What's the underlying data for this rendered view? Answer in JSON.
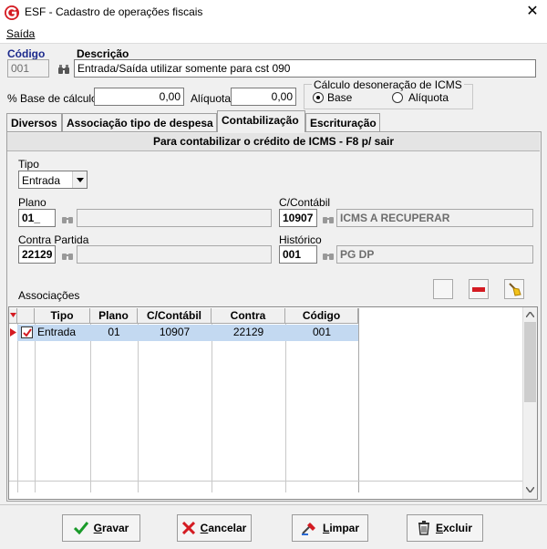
{
  "window": {
    "title": "ESF - Cadastro de operações fiscais",
    "close": "✕"
  },
  "menu": {
    "saida": "Saída"
  },
  "header": {
    "codigo_label": "Código",
    "codigo_value": "001",
    "descricao_label": "Descrição",
    "descricao_value": "Entrada/Saída utilizar somente para cst 090",
    "base_label": "% Base de cálculo",
    "base_value": "0,00",
    "aliquota_label": "Alíquota",
    "aliquota_value": "0,00",
    "calc_group_label": "Cálculo desoneração de ICMS",
    "radio_base": "Base",
    "radio_aliquota": "Alíquota",
    "radio_selected": "Base"
  },
  "tabs": [
    "Diversos",
    "Associação tipo de despesa",
    "Contabilização",
    "Escrituração"
  ],
  "active_tab": "Contabilização",
  "panel": {
    "title": "Para contabilizar o crédito de ICMS -  F8 p/ sair",
    "tipo_label": "Tipo",
    "tipo_value": "Entrada",
    "plano_label": "Plano",
    "plano_value": "01_",
    "ccontabil_label": "C/Contábil",
    "ccontabil_value": "10907",
    "ccontabil_desc": "ICMS A RECUPERAR",
    "contra_label": "Contra Partida",
    "contra_value": "22129",
    "historico_label": "Histórico",
    "historico_value": "001",
    "historico_desc": "PG DP",
    "assoc_label": "Associações"
  },
  "grid": {
    "columns": [
      "Tipo",
      "Plano",
      "C/Contábil",
      "Contra",
      "Código"
    ],
    "rows": [
      {
        "checked": true,
        "tipo": "Entrada",
        "plano": "01",
        "ccontabil": "10907",
        "contra": "22129",
        "codigo": "001"
      }
    ]
  },
  "buttons": {
    "gravar": "Gravar",
    "cancelar": "Cancelar",
    "limpar": "Limpar",
    "excluir": "Excluir"
  },
  "colors": {
    "accent_red": "#d41b22",
    "selected_row": "#c3d9f1",
    "label_blue": "#1c2a8c"
  }
}
